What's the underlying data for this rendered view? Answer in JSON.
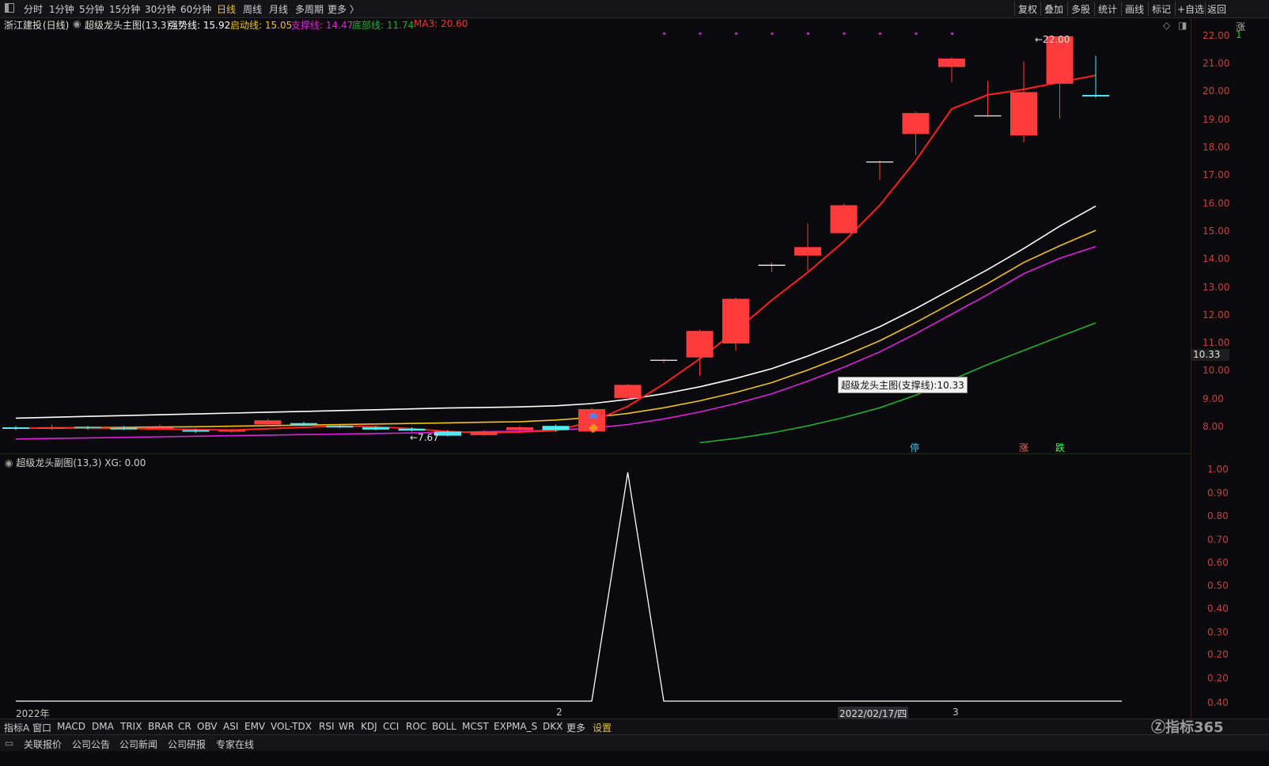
{
  "toolbar": {
    "periods": [
      "分时",
      "1分钟",
      "5分钟",
      "15分钟",
      "30分钟",
      "60分钟",
      "日线",
      "周线",
      "月线",
      "多周期",
      "更多 〉"
    ],
    "active_period": "日线",
    "right_buttons": [
      "复权",
      "叠加",
      "多股",
      "统计",
      "画线",
      "标记",
      "+自选",
      "返回"
    ]
  },
  "stock": {
    "name": "浙江建投",
    "period": "(日线)",
    "indicator": "超级龙头主图(13,3)",
    "strong_label": "强势线: 15.92",
    "start_label": "启动线: 15.05",
    "support_label": "支撑线: 14.47",
    "bottom_label": "底部线: 11.74",
    "ma_label": "MA3: 20.60"
  },
  "colors": {
    "strong": "#ffffff",
    "start": "#f0c020",
    "support": "#e020e0",
    "bottom": "#20b030",
    "ma": "#ff2020",
    "up_candle": "#ff3b3b",
    "down_candle": "#54e8f0",
    "axis": "#c84040"
  },
  "price_axis": {
    "ticks": [
      "22.00",
      "21.00",
      "20.00",
      "19.00",
      "18.00",
      "17.00",
      "16.00",
      "15.00",
      "14.00",
      "13.00",
      "12.00",
      "11.00",
      "10.00",
      "9.00",
      "8.00"
    ],
    "current": "10.33"
  },
  "annotations": {
    "high": "22.00",
    "low": "7.67",
    "tooltip": "超级龙头主图(支撑线):10.33",
    "tag_stop": "停",
    "tag_up": "涨",
    "tag_down": "跌"
  },
  "sub_indicator": {
    "label": "超级龙头副图(13,3)",
    "value": "XG: 0.00",
    "ticks": [
      "1.00",
      "0.90",
      "0.80",
      "0.70",
      "0.60",
      "0.50",
      "0.40",
      "0.30",
      "0.20",
      "0.20",
      "0.40"
    ]
  },
  "x_axis": {
    "year": "2022年",
    "month2": "2",
    "date": "2022/02/17/四",
    "month3": "3"
  },
  "indicator_tabs": [
    "指标A",
    "窗口",
    "MACD",
    "DMA",
    "TRIX",
    "BRAR",
    "CR",
    "OBV",
    "ASI",
    "EMV",
    "VOL-TDX",
    "RSI",
    "WR",
    "KDJ",
    "CCI",
    "ROC",
    "BOLL",
    "MCST",
    "EXPMA_S",
    "DKX",
    "更多",
    "设置"
  ],
  "bottom_links": [
    "关联报价",
    "公司公告",
    "公司新闻",
    "公司研报",
    "专家在线"
  ],
  "logo_text": "指标365",
  "chart_data": {
    "type": "candlestick",
    "title": "",
    "ylim": [
      7.5,
      22.2
    ],
    "candles": [
      {
        "o": 8.0,
        "c": 7.95,
        "h": 8.05,
        "l": 7.9
      },
      {
        "o": 7.95,
        "c": 8.0,
        "h": 8.1,
        "l": 7.9
      },
      {
        "o": 8.0,
        "c": 7.98,
        "h": 8.05,
        "l": 7.92
      },
      {
        "o": 7.98,
        "c": 7.95,
        "h": 8.05,
        "l": 7.9
      },
      {
        "o": 7.95,
        "c": 8.0,
        "h": 8.1,
        "l": 7.9
      },
      {
        "o": 7.9,
        "c": 7.85,
        "h": 7.95,
        "l": 7.8
      },
      {
        "o": 7.85,
        "c": 7.9,
        "h": 7.95,
        "l": 7.8
      },
      {
        "o": 8.1,
        "c": 8.25,
        "h": 8.3,
        "l": 8.05
      },
      {
        "o": 8.15,
        "c": 8.1,
        "h": 8.2,
        "l": 8.05
      },
      {
        "o": 8.05,
        "c": 8.0,
        "h": 8.1,
        "l": 7.98
      },
      {
        "o": 8.0,
        "c": 7.92,
        "h": 8.05,
        "l": 7.9
      },
      {
        "o": 7.95,
        "c": 7.88,
        "h": 8.0,
        "l": 7.85
      },
      {
        "o": 7.85,
        "c": 7.7,
        "h": 7.9,
        "l": 7.67
      },
      {
        "o": 7.72,
        "c": 7.85,
        "h": 7.9,
        "l": 7.7
      },
      {
        "o": 7.9,
        "c": 8.0,
        "h": 8.05,
        "l": 7.85
      },
      {
        "o": 8.05,
        "c": 7.9,
        "h": 8.1,
        "l": 7.85
      },
      {
        "o": 7.85,
        "c": 8.65,
        "h": 8.7,
        "l": 7.8
      },
      {
        "o": 9.05,
        "c": 9.52,
        "h": 9.55,
        "l": 9.0
      },
      {
        "o": 10.4,
        "c": 10.4,
        "h": 10.45,
        "l": 10.3
      },
      {
        "o": 10.5,
        "c": 11.45,
        "h": 11.5,
        "l": 9.85
      },
      {
        "o": 11.0,
        "c": 12.6,
        "h": 12.65,
        "l": 10.75
      },
      {
        "o": 13.8,
        "c": 13.8,
        "h": 13.9,
        "l": 13.55
      },
      {
        "o": 14.15,
        "c": 14.45,
        "h": 15.3,
        "l": 13.6
      },
      {
        "o": 14.95,
        "c": 15.95,
        "h": 16.0,
        "l": 14.95
      },
      {
        "o": 17.5,
        "c": 17.5,
        "h": 17.55,
        "l": 16.85
      },
      {
        "o": 18.5,
        "c": 19.25,
        "h": 19.3,
        "l": 17.75
      },
      {
        "o": 20.9,
        "c": 21.2,
        "h": 21.25,
        "l": 20.35
      },
      {
        "o": 19.15,
        "c": 19.15,
        "h": 20.4,
        "l": 19.1
      },
      {
        "o": 18.45,
        "c": 20.0,
        "h": 21.1,
        "l": 18.2
      },
      {
        "o": 20.3,
        "c": 22.0,
        "h": 22.0,
        "l": 19.05
      },
      {
        "o": 19.9,
        "c": 19.85,
        "h": 21.3,
        "l": 19.8
      }
    ],
    "series": [
      {
        "name": "强势线",
        "values": [
          8.33,
          8.36,
          8.39,
          8.42,
          8.45,
          8.48,
          8.51,
          8.54,
          8.57,
          8.6,
          8.63,
          8.66,
          8.69,
          8.71,
          8.73,
          8.77,
          8.85,
          9.0,
          9.2,
          9.45,
          9.75,
          10.1,
          10.55,
          11.05,
          11.6,
          12.25,
          12.95,
          13.65,
          14.4,
          15.2,
          15.92
        ]
      },
      {
        "name": "启动线",
        "values": [
          7.97,
          7.98,
          7.99,
          8.0,
          8.01,
          8.02,
          8.04,
          8.06,
          8.08,
          8.1,
          8.12,
          8.14,
          8.16,
          8.18,
          8.2,
          8.26,
          8.35,
          8.5,
          8.7,
          8.95,
          9.25,
          9.6,
          10.05,
          10.55,
          11.1,
          11.75,
          12.45,
          13.15,
          13.9,
          14.5,
          15.05
        ]
      },
      {
        "name": "支撑线",
        "values": [
          7.58,
          7.6,
          7.62,
          7.64,
          7.66,
          7.68,
          7.7,
          7.72,
          7.74,
          7.76,
          7.78,
          7.8,
          7.82,
          7.84,
          7.86,
          7.9,
          7.97,
          8.1,
          8.3,
          8.55,
          8.85,
          9.2,
          9.65,
          10.15,
          10.7,
          11.35,
          12.05,
          12.75,
          13.5,
          14.05,
          14.47
        ]
      },
      {
        "name": "底部线",
        "values": [
          null,
          null,
          null,
          null,
          null,
          null,
          null,
          null,
          null,
          null,
          null,
          null,
          null,
          null,
          null,
          null,
          null,
          null,
          null,
          7.45,
          7.6,
          7.8,
          8.05,
          8.35,
          8.7,
          9.15,
          9.7,
          10.25,
          10.75,
          11.25,
          11.74
        ]
      },
      {
        "name": "MA3",
        "values": [
          7.97,
          7.98,
          7.97,
          7.96,
          7.94,
          7.92,
          7.9,
          7.95,
          8.0,
          8.05,
          8.02,
          7.95,
          7.85,
          7.8,
          7.83,
          7.88,
          8.2,
          8.75,
          9.55,
          10.45,
          11.45,
          12.55,
          13.55,
          14.65,
          15.95,
          17.55,
          19.4,
          19.9,
          20.1,
          20.35,
          20.6
        ]
      }
    ],
    "sub_series": {
      "name": "XG",
      "values": [
        0,
        0,
        0,
        0,
        0,
        0,
        0,
        0,
        0,
        0,
        0,
        0,
        0,
        0,
        0,
        0,
        0,
        1,
        0,
        0,
        0,
        0,
        0,
        0,
        0,
        0,
        0,
        0,
        0,
        0,
        0
      ]
    }
  }
}
